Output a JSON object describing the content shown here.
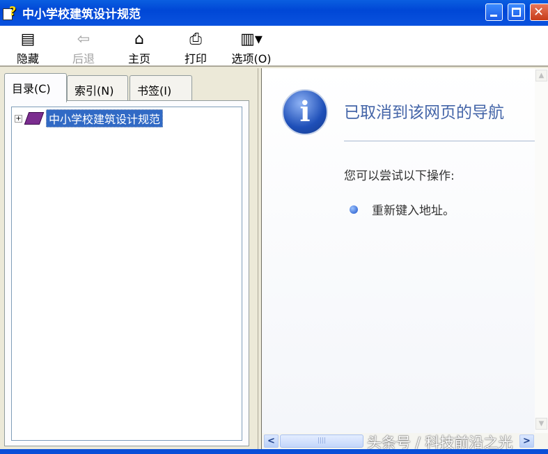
{
  "window": {
    "title": "中小学校建筑设计规范"
  },
  "toolbar": {
    "hide": "隐藏",
    "back": "后退",
    "home": "主页",
    "print": "打印",
    "options": "选项(O)"
  },
  "tabs": [
    {
      "label": "目录(C)"
    },
    {
      "label": "索引(N)"
    },
    {
      "label": "书签(I)"
    }
  ],
  "tree": {
    "root": "中小学校建筑设计规范"
  },
  "content": {
    "heading": "已取消到该网页的导航",
    "try_label": "您可以尝试以下操作:",
    "actions": [
      "重新键入地址。"
    ]
  },
  "watermark": "头条号 / 科技前沿之光"
}
